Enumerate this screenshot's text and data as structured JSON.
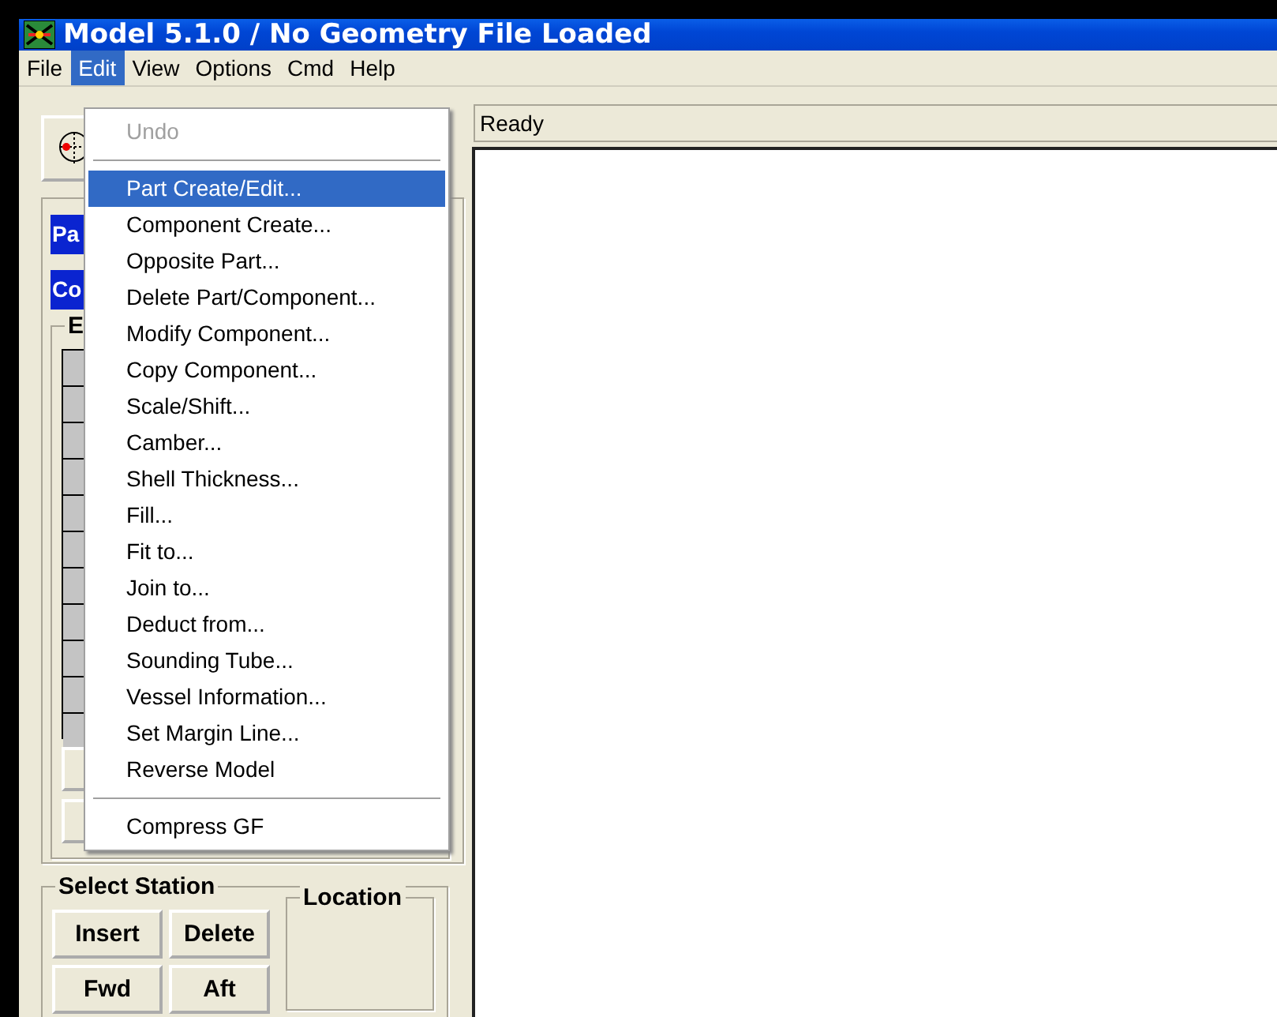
{
  "window": {
    "title": "Model 5.1.0 / No Geometry File Loaded"
  },
  "menu_bar": [
    {
      "label": "File",
      "selected": false
    },
    {
      "label": "Edit",
      "selected": true
    },
    {
      "label": "View",
      "selected": false
    },
    {
      "label": "Options",
      "selected": false
    },
    {
      "label": "Cmd",
      "selected": false
    },
    {
      "label": "Help",
      "selected": false
    }
  ],
  "edit_menu": [
    {
      "kind": "item",
      "label": "Undo",
      "disabled": true,
      "selected": false
    },
    {
      "kind": "separator"
    },
    {
      "kind": "item",
      "label": "Part Create/Edit...",
      "disabled": false,
      "selected": true
    },
    {
      "kind": "item",
      "label": "Component Create...",
      "disabled": false,
      "selected": false
    },
    {
      "kind": "item",
      "label": "Opposite Part...",
      "disabled": false,
      "selected": false
    },
    {
      "kind": "item",
      "label": "Delete Part/Component...",
      "disabled": false,
      "selected": false
    },
    {
      "kind": "item",
      "label": "Modify Component...",
      "disabled": false,
      "selected": false
    },
    {
      "kind": "item",
      "label": "Copy Component...",
      "disabled": false,
      "selected": false
    },
    {
      "kind": "item",
      "label": "Scale/Shift...",
      "disabled": false,
      "selected": false
    },
    {
      "kind": "item",
      "label": "Camber...",
      "disabled": false,
      "selected": false
    },
    {
      "kind": "item",
      "label": "Shell Thickness...",
      "disabled": false,
      "selected": false
    },
    {
      "kind": "item",
      "label": "Fill...",
      "disabled": false,
      "selected": false
    },
    {
      "kind": "item",
      "label": "Fit to...",
      "disabled": false,
      "selected": false
    },
    {
      "kind": "item",
      "label": "Join to...",
      "disabled": false,
      "selected": false
    },
    {
      "kind": "item",
      "label": "Deduct from...",
      "disabled": false,
      "selected": false
    },
    {
      "kind": "item",
      "label": "Sounding Tube...",
      "disabled": false,
      "selected": false
    },
    {
      "kind": "item",
      "label": "Vessel Information...",
      "disabled": false,
      "selected": false
    },
    {
      "kind": "item",
      "label": "Set Margin Line...",
      "disabled": false,
      "selected": false
    },
    {
      "kind": "item",
      "label": "Reverse Model",
      "disabled": false,
      "selected": false
    },
    {
      "kind": "separator"
    },
    {
      "kind": "item",
      "label": "Compress GF",
      "disabled": false,
      "selected": false
    }
  ],
  "left_panel": {
    "mode_items": [
      "Pa",
      "Co"
    ],
    "list_group": {
      "title": "E"
    },
    "select_station": {
      "title": "Select Station",
      "buttons": [
        "Insert",
        "Delete",
        "Fwd",
        "Aft"
      ],
      "location_title": "Location"
    }
  },
  "status": "Ready"
}
